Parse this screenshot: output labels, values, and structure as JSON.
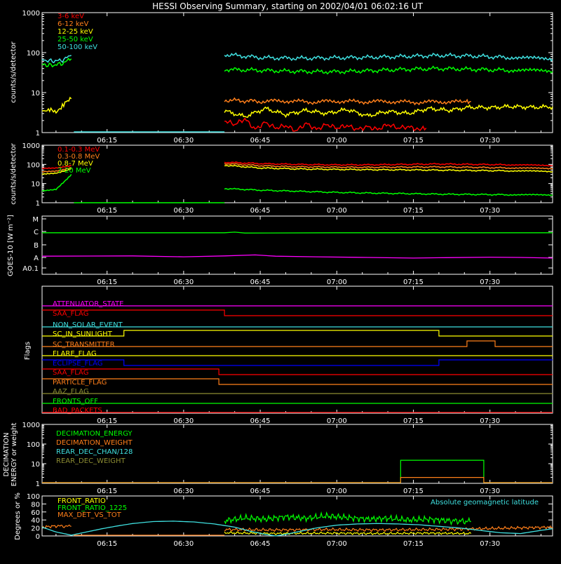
{
  "title": "HESSI Observing Summary, starting on 2002/04/01 06:02:16 UT",
  "x_tick_labels": [
    "06:15",
    "06:30",
    "06:45",
    "07:00",
    "07:15",
    "07:30"
  ],
  "x_tick_times_min": [
    15,
    30,
    45,
    60,
    75,
    90
  ],
  "colors": {
    "red": "#ff0000",
    "orange": "#ff7f1a",
    "yellow": "#ffff00",
    "green": "#00ff00",
    "cyan": "#3fe0e0",
    "magenta": "#ff00ff",
    "blue": "#0000ff",
    "olive": "#8c8c32"
  },
  "chart_data": [
    {
      "type": "line",
      "panel": "hi-energy",
      "ylabel": "counts/s/detector",
      "y_scale": "log",
      "ylim": [
        1,
        1000
      ],
      "y_ticks": [
        "1",
        "10",
        "100",
        "1000"
      ],
      "x_range_min": [
        2.27,
        102.27
      ],
      "legend": [
        "3-6 keV",
        "6-12 keV",
        "12-25 keV",
        "25-50 keV",
        "50-100 keV"
      ],
      "legend_colors": [
        "red",
        "orange",
        "yellow",
        "green",
        "cyan"
      ],
      "series": [
        {
          "name": "3-6 keV",
          "color": "red",
          "segments": [
            {
              "x": [
                38.0,
                40,
                42,
                44,
                46,
                48,
                50,
                52,
                54,
                56,
                58,
                60,
                62,
                64,
                66,
                68,
                70,
                72,
                74,
                76,
                77.5
              ],
              "y": [
                2.0,
                1.6,
                2.2,
                1.2,
                1.8,
                1.3,
                1.5,
                1.1,
                1.7,
                1.2,
                1.6,
                1.3,
                1.5,
                1.2,
                1.4,
                1.2,
                1.6,
                1.3,
                1.4,
                1.2,
                1.3
              ]
            }
          ]
        },
        {
          "name": "6-12 keV",
          "color": "orange",
          "segments": [
            {
              "x": [
                38.0,
                45,
                50,
                55,
                60,
                65,
                70,
                75,
                80,
                85,
                86.3
              ],
              "y": [
                6.5,
                6,
                6.2,
                5.8,
                6.1,
                5.9,
                6.0,
                5.7,
                5.9,
                5.8,
                6.0
              ]
            }
          ]
        },
        {
          "name": "12-25 keV",
          "color": "yellow",
          "segments": [
            {
              "x": [
                2.27,
                3,
                4,
                5,
                6,
                7,
                8
              ],
              "y": [
                3.5,
                3.5,
                3.8,
                3.2,
                4.2,
                6,
                7
              ]
            },
            {
              "x": [
                38.0,
                42,
                46,
                50,
                54,
                58,
                62,
                66,
                70,
                74,
                78,
                82,
                86,
                90,
                94,
                98,
                102.27
              ],
              "y": [
                3.5,
                2.5,
                4,
                2.8,
                3.6,
                3,
                3.8,
                2.6,
                3.4,
                3,
                4,
                3.6,
                4.3,
                4.2,
                4.5,
                4.3,
                4.4
              ]
            }
          ]
        },
        {
          "name": "25-50 keV",
          "color": "green",
          "segments": [
            {
              "x": [
                2.27,
                4,
                6,
                8
              ],
              "y": [
                50,
                48,
                52,
                70
              ]
            },
            {
              "x": [
                38.0,
                45,
                52,
                59,
                66,
                73,
                80,
                87,
                94,
                102.27
              ],
              "y": [
                38,
                36,
                34,
                33,
                35,
                38,
                40,
                38,
                36,
                34
              ]
            }
          ]
        },
        {
          "name": "50-100 keV",
          "color": "cyan",
          "segments": [
            {
              "x": [
                2.27,
                4,
                6,
                8
              ],
              "y": [
                65,
                62,
                63,
                85
              ]
            },
            {
              "x": [
                38.0,
                45,
                52,
                59,
                66,
                73,
                80,
                87,
                94,
                102.27
              ],
              "y": [
                90,
                75,
                72,
                74,
                76,
                80,
                85,
                82,
                75,
                68
              ]
            }
          ]
        }
      ]
    },
    {
      "type": "line",
      "panel": "gamma",
      "ylabel": "counts/s/detector",
      "y_scale": "log",
      "ylim": [
        1,
        1000
      ],
      "y_ticks": [
        "1",
        "10",
        "100",
        "1000"
      ],
      "x_range_min": [
        2.27,
        102.27
      ],
      "legend": [
        "0.1-0.3 MeV",
        "0.3-0.8 MeV",
        "0.8-7 MeV",
        "7-20 MeV"
      ],
      "legend_colors": [
        "red",
        "orange",
        "yellow",
        "green"
      ],
      "series": [
        {
          "name": "0.1-0.3 MeV",
          "color": "red",
          "segments": [
            {
              "x": [
                2.27,
                5,
                8
              ],
              "y": [
                60,
                65,
                90
              ]
            },
            {
              "x": [
                38.0,
                45,
                52,
                59,
                66,
                73,
                80,
                87,
                94,
                102.27
              ],
              "y": [
                130,
                110,
                100,
                95,
                95,
                100,
                105,
                100,
                95,
                85
              ]
            }
          ]
        },
        {
          "name": "0.3-0.8 MeV",
          "color": "orange",
          "segments": [
            {
              "x": [
                2.27,
                5,
                8
              ],
              "y": [
                40,
                45,
                70
              ]
            },
            {
              "x": [
                38.0,
                45,
                52,
                59,
                66,
                73,
                80,
                87,
                94,
                102.27
              ],
              "y": [
                110,
                85,
                75,
                72,
                70,
                72,
                74,
                70,
                65,
                60
              ]
            }
          ]
        },
        {
          "name": "0.8-7 MeV",
          "color": "yellow",
          "segments": [
            {
              "x": [
                2.27,
                5,
                8
              ],
              "y": [
                30,
                35,
                60
              ]
            },
            {
              "x": [
                38.0,
                45,
                52,
                59,
                66,
                73,
                80,
                87,
                94,
                102.27
              ],
              "y": [
                90,
                65,
                58,
                55,
                53,
                52,
                50,
                48,
                46,
                42
              ]
            }
          ]
        },
        {
          "name": "7-20 MeV",
          "color": "green",
          "segments": [
            {
              "x": [
                2.27,
                5,
                8
              ],
              "y": [
                4,
                5,
                30
              ]
            },
            {
              "x": [
                38.0,
                45,
                52,
                59,
                66,
                73,
                80,
                87,
                94,
                102.27
              ],
              "y": [
                5.5,
                4.5,
                4,
                3.5,
                3.2,
                3.0,
                2.8,
                2.7,
                2.6,
                2.5
              ]
            }
          ]
        }
      ]
    },
    {
      "type": "line",
      "panel": "goes",
      "ylabel": "GOES-10 [W m⁻²]",
      "y_ticks": [
        "A0.1",
        "A",
        "B",
        "C",
        "M"
      ],
      "series": [
        {
          "color": "green",
          "level": "C",
          "segments": [
            {
              "x": [
                2.27,
                38,
                40,
                42,
                60,
                102.27
              ],
              "y": [
                -0.1,
                -0.1,
                -0.05,
                -0.12,
                -0.1,
                -0.1
              ]
            }
          ]
        },
        {
          "color": "magenta",
          "level": "A",
          "segments": [
            {
              "x": [
                2.27,
                20,
                30,
                38,
                44,
                48,
                56,
                66,
                75,
                80,
                90,
                96,
                102.27
              ],
              "y": [
                0.1,
                0.12,
                0.05,
                0.12,
                0.2,
                0.1,
                0.05,
                0.0,
                -0.05,
                -0.02,
                0.02,
                0.0,
                -0.05
              ]
            }
          ]
        }
      ]
    },
    {
      "type": "line",
      "panel": "flags",
      "ylabel": "Flags",
      "series": [
        {
          "name": "ATTENUATOR_STATE",
          "color": "magenta",
          "transitions": [
            [
              2.27,
              0
            ]
          ]
        },
        {
          "name": "SAA_FLAG",
          "color": "red",
          "transitions": [
            [
              2.27,
              1
            ],
            [
              38.0,
              0
            ]
          ]
        },
        {
          "name": "NON_SOLAR_EVENT",
          "color": "cyan",
          "transitions": [
            [
              2.27,
              0
            ]
          ]
        },
        {
          "name": "SC_IN_SUNLIGHT",
          "color": "yellow",
          "transitions": [
            [
              2.27,
              0
            ],
            [
              18.3,
              1
            ],
            [
              80.0,
              0
            ]
          ]
        },
        {
          "name": "SC_TRANSMITTER",
          "color": "orange",
          "transitions": [
            [
              2.27,
              0
            ],
            [
              85.5,
              1
            ],
            [
              91.0,
              0
            ]
          ]
        },
        {
          "name": "FLARE_FLAG",
          "color": "yellow",
          "transitions": [
            [
              2.27,
              0
            ]
          ]
        },
        {
          "name": "ECLIPSE_FLAG",
          "color": "blue",
          "transitions": [
            [
              2.27,
              1
            ],
            [
              18.3,
              0
            ],
            [
              80.0,
              1
            ]
          ]
        },
        {
          "name": "SAA_FLAG",
          "color": "red",
          "transitions": [
            [
              2.27,
              1
            ],
            [
              36.9,
              0
            ]
          ]
        },
        {
          "name": "PARTICLE_FLAG",
          "color": "orange",
          "transitions": [
            [
              2.27,
              1
            ],
            [
              36.9,
              0
            ]
          ]
        },
        {
          "name": "AAZ_FLAG",
          "color": "olive",
          "transitions": [
            [
              2.27,
              0
            ]
          ]
        },
        {
          "name": "FRONTS_OFF",
          "color": "green",
          "transitions": [
            [
              2.27,
              0
            ]
          ]
        },
        {
          "name": "BAD_PACKETS",
          "color": "red",
          "transitions": [
            [
              2.27,
              0
            ]
          ]
        }
      ]
    },
    {
      "type": "line",
      "panel": "decimation",
      "ylabel": "DECIMATION ENERGY or weight",
      "y_scale": "log",
      "ylim": [
        1,
        1000
      ],
      "y_ticks": [
        "1",
        "10",
        "100",
        "1000"
      ],
      "legend": [
        "DECIMATION_ENERGY",
        "DECIMATION_WEIGHT",
        "REAR_DEC_CHAN/128",
        "REAR_DEC_WEIGHT"
      ],
      "legend_colors": [
        "green",
        "orange",
        "cyan",
        "olive"
      ],
      "series": [
        {
          "name": "DECIMATION_ENERGY",
          "color": "green",
          "segments": [
            {
              "x": [
                2.27,
                72.5,
                72.5,
                88.8,
                88.8,
                102.27
              ],
              "y": [
                1,
                1,
                15,
                15,
                1,
                1
              ]
            }
          ]
        },
        {
          "name": "DECIMATION_WEIGHT",
          "color": "orange",
          "segments": [
            {
              "x": [
                2.27,
                72.5,
                72.5,
                88.8,
                88.8,
                102.27
              ],
              "y": [
                1,
                1,
                2,
                2,
                1,
                1
              ]
            }
          ]
        }
      ]
    },
    {
      "type": "line",
      "panel": "ratios",
      "ylabel": "Degrees or %",
      "ylim": [
        0,
        100
      ],
      "y_ticks": [
        "0",
        "20",
        "40",
        "60",
        "80",
        "100"
      ],
      "legend": [
        "FRONT_RATIO",
        "FRONT_RATIO_1225",
        "MAX_DET_VS_TOT"
      ],
      "legend_colors": [
        "yellow",
        "green",
        "orange"
      ],
      "right_legend": "Absolute geomagnetic latitude",
      "series": [
        {
          "name": "FRONT_RATIO",
          "color": "yellow",
          "segments": [
            {
              "x": [
                38.0,
                48,
                58,
                68,
                78,
                86.3
              ],
              "y": [
                8,
                6,
                7,
                6,
                7,
                6
              ]
            }
          ]
        },
        {
          "name": "FRONT_RATIO_1225",
          "color": "green",
          "segments": [
            {
              "x": [
                38.0,
                42,
                46,
                50,
                54,
                58,
                62,
                66,
                70,
                74,
                78,
                82,
                86.3
              ],
              "y": [
                38,
                45,
                42,
                48,
                44,
                50,
                46,
                42,
                44,
                40,
                42,
                38,
                36
              ]
            }
          ]
        },
        {
          "name": "MAX_DET_VS_TOT",
          "color": "orange",
          "segments": [
            {
              "x": [
                2.27,
                5,
                8
              ],
              "y": [
                22,
                25,
                24
              ]
            },
            {
              "x": [
                38.0,
                48,
                58,
                68,
                78,
                88,
                95,
                102.27
              ],
              "y": [
                16,
                15,
                16,
                15,
                16,
                18,
                20,
                22
              ]
            }
          ]
        },
        {
          "name": "Absolute geomagnetic latitude",
          "color": "cyan",
          "segments": [
            {
              "x": [
                2.27,
                5,
                8,
                11,
                14,
                17,
                20,
                24,
                28,
                32,
                36,
                40,
                43,
                46,
                48,
                50,
                53,
                56,
                60,
                64,
                68,
                72,
                76,
                80,
                84,
                88,
                92,
                96,
                100,
                102.27
              ],
              "y": [
                22,
                10,
                2,
                10,
                18,
                25,
                31,
                36,
                37,
                35,
                30,
                22,
                12,
                4,
                0,
                4,
                12,
                20,
                27,
                30,
                31,
                30,
                28,
                24,
                20,
                14,
                8,
                6,
                14,
                18
              ]
            }
          ]
        }
      ]
    }
  ]
}
